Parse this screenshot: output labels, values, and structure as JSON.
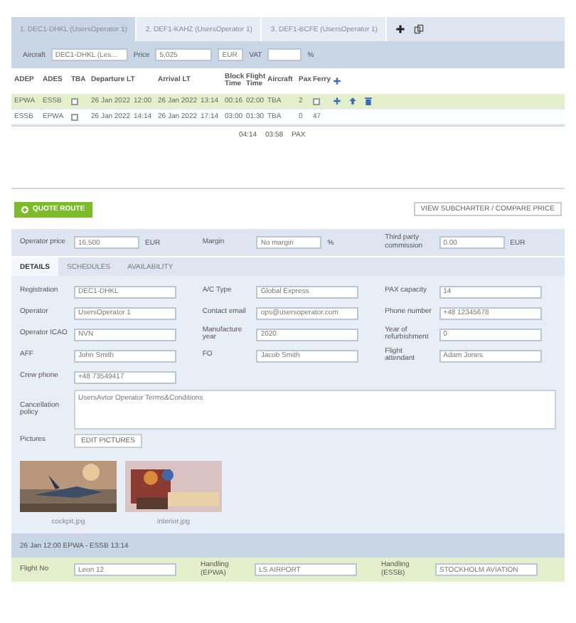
{
  "tabs": [
    {
      "label": "1. DEC1-DHKL (UsersOperator 1)",
      "selected": true
    },
    {
      "label": "2. DEF1-KAHZ (UsersOperator 1)",
      "selected": false
    },
    {
      "label": "3. DEF1-BCFE (UsersOperator 1)",
      "selected": false
    }
  ],
  "filter": {
    "aircraft_label": "Aircraft",
    "aircraft": "DEC1-DHKL (Les...",
    "price_label": "Price",
    "price": "5,025",
    "currency": "EUR",
    "vat_label": "VAT",
    "vat_unit": "%"
  },
  "table": {
    "columns": [
      "ADEP",
      "ADES",
      "TBA",
      "Departure LT",
      "Arrival LT",
      "Block Time",
      "Flight Time",
      "Aircraft",
      "Pax",
      "Ferry"
    ],
    "rows": [
      {
        "selected": true,
        "adep": "EPWA",
        "ades": "ESSB",
        "tba": false,
        "dep_date": "26 Jan 2022",
        "dep_time": "12:00",
        "arr_date": "26 Jan 2022",
        "arr_time": "13:14",
        "block": "00:16",
        "flight": "02:00",
        "aircraft": "TBA",
        "pax": "2",
        "ferry": false
      },
      {
        "selected": false,
        "adep": "ESSB",
        "ades": "EPWA",
        "tba": false,
        "dep_date": "26 Jan 2022",
        "dep_time": "14:14",
        "arr_date": "26 Jan 2022",
        "arr_time": "17:14",
        "block": "03:00",
        "flight": "01:30",
        "aircraft": "TBA",
        "pax": "0",
        "ferry_text": "47"
      }
    ],
    "totals": [
      "04:14",
      "03:58",
      "PAX"
    ]
  },
  "actions": {
    "primary": "QUOTE ROUTE",
    "secondary": "VIEW SUBCHARTER / COMPARE PRICE"
  },
  "pricing": [
    {
      "label": "Operator price",
      "value": "16,500",
      "unit": "EUR"
    },
    {
      "label": "Margin",
      "value": "No margin",
      "unit": "%"
    },
    {
      "label": "Third party commission",
      "value": "0.00",
      "unit": "EUR"
    }
  ],
  "detail_tabs": [
    {
      "label": "DETAILS",
      "selected": true
    },
    {
      "label": "SCHEDULES",
      "selected": false
    },
    {
      "label": "AVAILABILITY",
      "selected": false
    }
  ],
  "fields": [
    {
      "label": "Registration",
      "value": "DEC1-DHKL"
    },
    {
      "label": "A/C Type",
      "value": "Global Express"
    },
    {
      "label": "PAX capacity",
      "value": "14"
    },
    {
      "label": "Operator",
      "value": "UsersOperator 1"
    },
    {
      "label": "Contact email",
      "value": "ops@usersoperator.com"
    },
    {
      "label": "Phone number",
      "value": "+48 12345678"
    },
    {
      "label": "Operator ICAO",
      "value": "NVN"
    },
    {
      "label": "Manufacture year",
      "value": "2020"
    },
    {
      "label": "Year of refurbishment",
      "value": "0"
    },
    {
      "label": "AFF",
      "value": "John Smith"
    },
    {
      "label": "FO",
      "value": "Jacob Smith"
    },
    {
      "label": "Flight attendant",
      "value": "Adam Jones"
    },
    {
      "label": "Crew phone",
      "value": "+48 73549417"
    }
  ],
  "cancellation": {
    "label": "Cancellation policy",
    "value": "UsersAvtor Operator Terms&Conditions"
  },
  "pictures": {
    "label": "Pictures",
    "button": "EDIT PICTURES",
    "items": [
      {
        "caption": "cockpit.jpg"
      },
      {
        "caption": "interior.jpg"
      }
    ]
  },
  "leg": {
    "title": "26 Jan 12:00 EPWA - ESSB 13:14"
  },
  "leg_fields": [
    {
      "label": "Flight No",
      "value": "Leon 12"
    },
    {
      "label": "Handling (EPWA)",
      "value": "LS AIRPORT"
    },
    {
      "label": "Handling (ESSB)",
      "value": "STOCKHOLM AVIATION"
    }
  ]
}
